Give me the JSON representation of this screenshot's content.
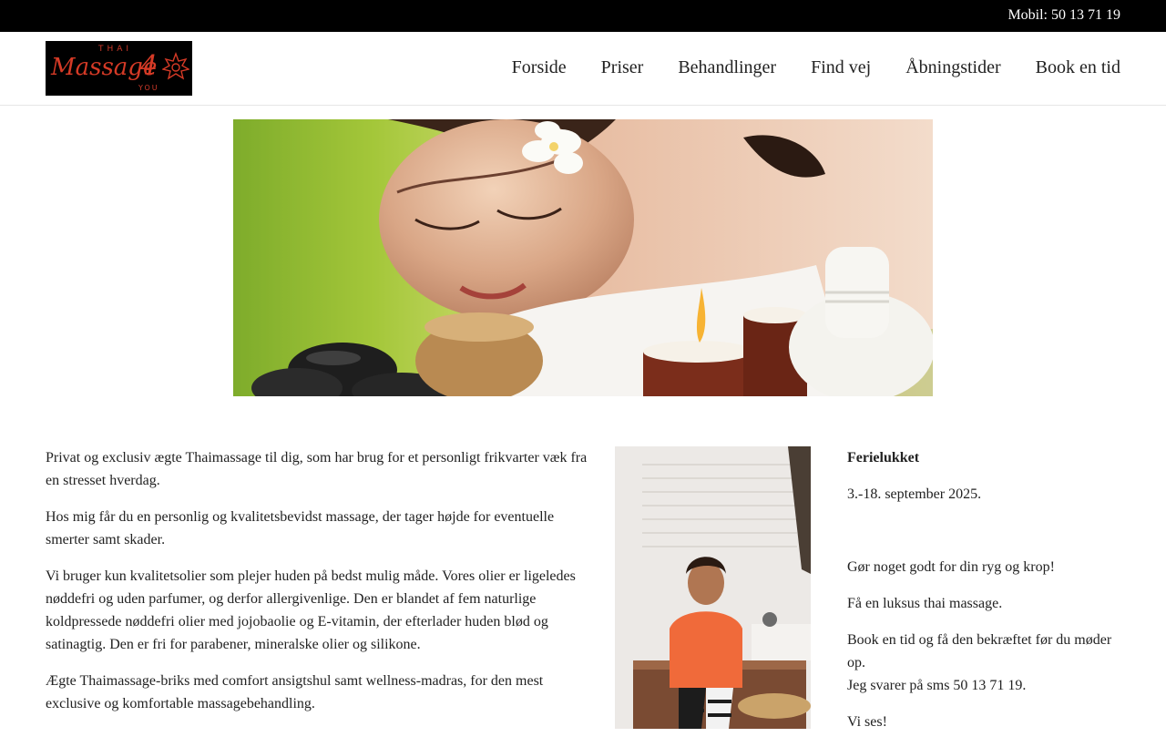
{
  "topbar": {
    "mobile_text": "Mobil: 50 13 71 19"
  },
  "logo": {
    "top_text": "THAI",
    "main_text": "Massage",
    "number": "4",
    "bottom_text": "YOU"
  },
  "nav": {
    "items": [
      {
        "label": "Forside"
      },
      {
        "label": "Priser"
      },
      {
        "label": "Behandlinger"
      },
      {
        "label": "Find vej"
      },
      {
        "label": "Åbningstider"
      },
      {
        "label": "Book en tid"
      }
    ]
  },
  "content": {
    "paragraphs": [
      "Privat og exclusiv ægte Thaimassage til dig, som har brug for et personligt frikvarter væk fra en stresset hverdag.",
      "Hos mig får du en personlig og kvalitetsbevidst massage, der tager højde for eventuelle smerter samt skader.",
      "Vi bruger kun kvalitetsolier som plejer huden på bedst mulig måde. Vores olier er ligeledes nøddefri og uden parfumer, og derfor allergivenlige. Den er blandet af fem naturlige koldpressede nøddefri olier med jojobaolie og E-vitamin, der efterlader huden blød og satinagtig. Den er fri for parabener, mineralske olier og silikone.",
      "Ægte Thaimassage-briks med comfort ansigtshul samt wellness-madras, for den mest exclusive og komfortable massagebehandling."
    ]
  },
  "sidebar": {
    "title": "Ferielukket",
    "closed_dates": "3.-18. september 2025.",
    "line1": "Gør noget godt for din ryg og krop!",
    "line2": "Få en luksus thai massage.",
    "line3a": "Book en tid og få den bekræftet før du møder op.",
    "line3b": "Jeg svarer på sms 50 13 71 19.",
    "line4": "Vi ses!"
  }
}
